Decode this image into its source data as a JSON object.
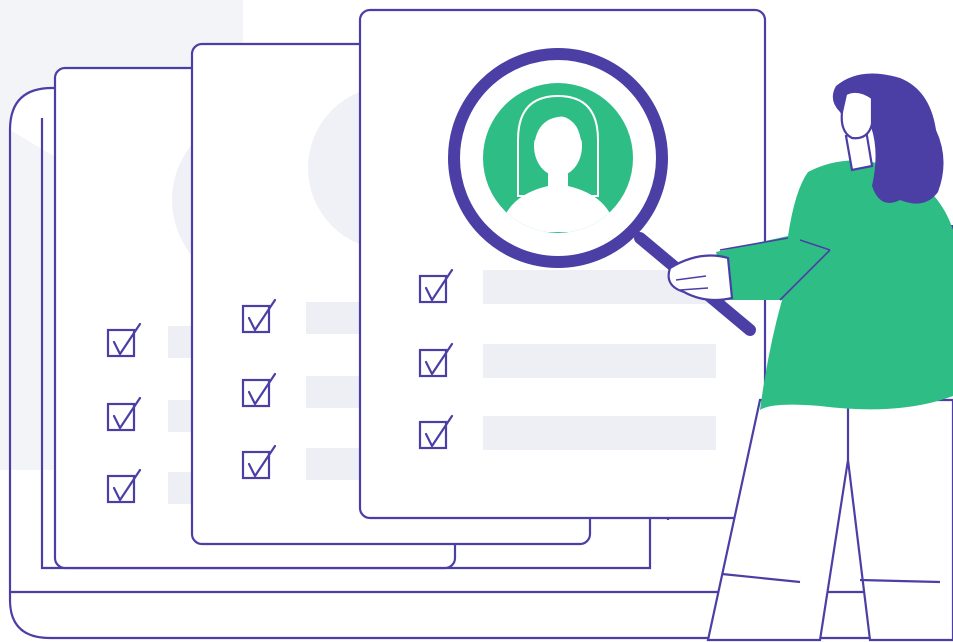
{
  "colors": {
    "outline": "#4b3fa6",
    "accent_green": "#2ebd85",
    "hair_purple": "#4b3fa6",
    "placeholder_gray": "#eeeff5",
    "background_panel": "#f3f4f8",
    "paper": "#ffffff",
    "skin": "#ffffff"
  },
  "cards": [
    {
      "name": "back-card",
      "checklist_items": 3,
      "checked": [
        true,
        true,
        true
      ]
    },
    {
      "name": "middle-card",
      "checklist_items": 3,
      "checked": [
        true,
        true,
        true
      ]
    },
    {
      "name": "front-card",
      "checklist_items": 3,
      "checked": [
        true,
        true,
        true
      ]
    }
  ],
  "icons": [
    "checkbox-checked-icon",
    "magnifying-glass-icon",
    "profile-avatar-icon"
  ]
}
